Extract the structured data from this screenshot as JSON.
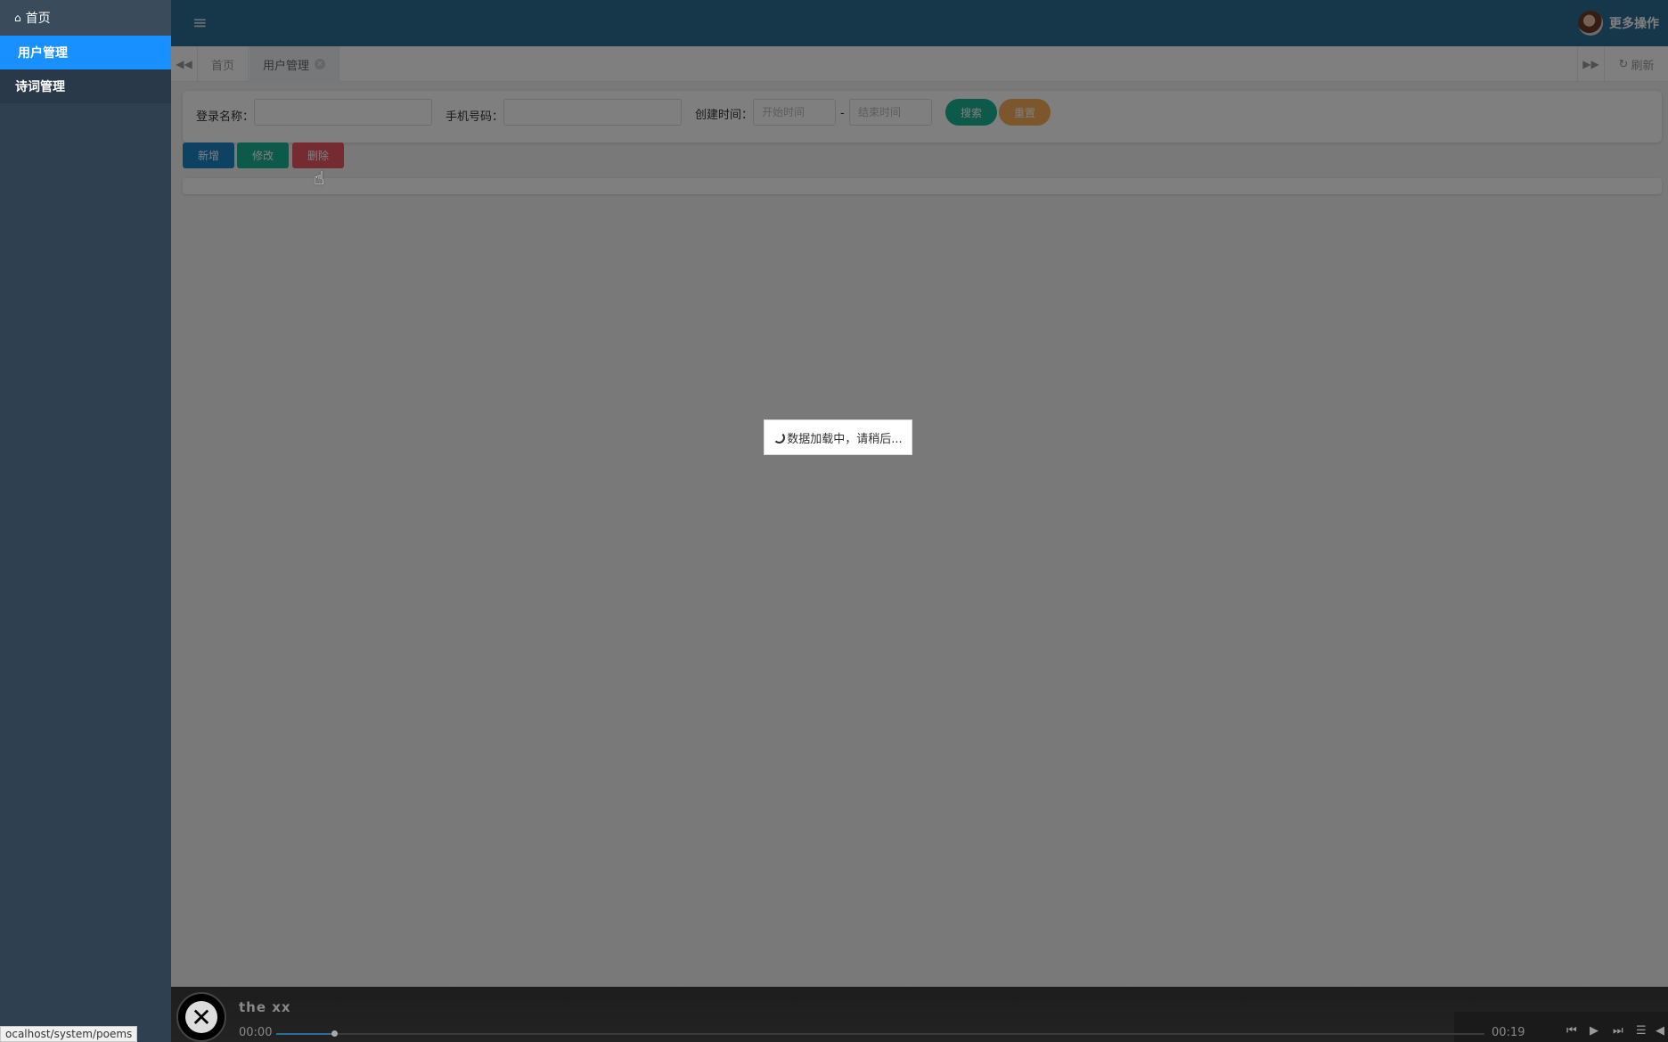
{
  "sidebar": {
    "home_label": "首页",
    "items": [
      {
        "label": "用户管理",
        "active": true
      },
      {
        "label": "诗词管理",
        "active": false
      }
    ]
  },
  "topbar": {
    "menu_icon": "hamburger-icon",
    "user_action_label": "更多操作"
  },
  "tabs": {
    "items": [
      {
        "label": "首页"
      },
      {
        "label": "用户管理"
      }
    ],
    "refresh_label": "刷新"
  },
  "search_form": {
    "login_name_label": "登录名称：",
    "login_name_value": "",
    "phone_label": "手机号码：",
    "phone_value": "",
    "create_time_label": "创建时间：",
    "start_placeholder": "开始时间",
    "range_separator": "-",
    "end_placeholder": "结束时间",
    "search_label": "搜索",
    "reset_label": "重置"
  },
  "toolbar": {
    "add_label": "新增",
    "edit_label": "修改",
    "delete_label": "删除"
  },
  "loading": {
    "text": "数据加载中，请稍后..."
  },
  "player": {
    "track_title": "the xx",
    "time_current": "00:00",
    "time_total": "00:19",
    "progress": 0.049
  },
  "status_url": "ocalhost/system/poems",
  "colors": {
    "sidebar_bg": "#2f4050",
    "active_menu": "#1890ff",
    "topbar_bg": "#2c6e95",
    "btn_primary": "#1c84c6",
    "btn_success": "#1ab394",
    "btn_danger": "#ed5565",
    "btn_warning": "#f8ac59"
  }
}
